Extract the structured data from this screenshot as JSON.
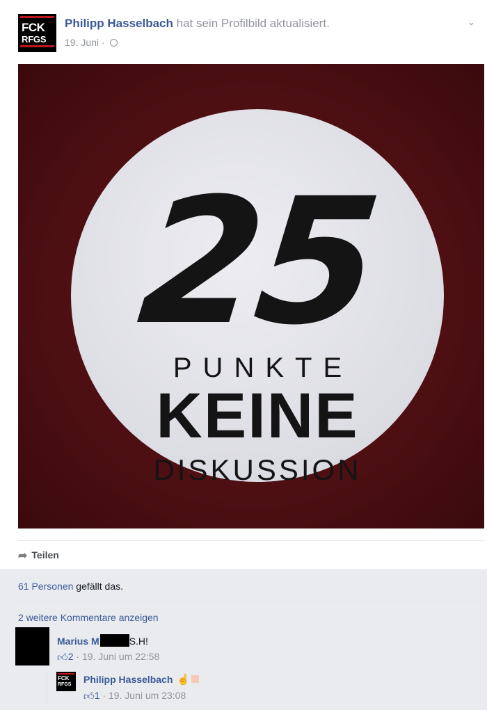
{
  "post": {
    "author": "Philipp Hasselbach",
    "action": "hat sein Profilbild aktualisiert.",
    "date": "19. Juni",
    "separator": "·",
    "avatar": {
      "line1": "FCK",
      "line2": "RFGS"
    },
    "icons": {
      "audience": "globe-icon",
      "options": "chevron-down-icon"
    }
  },
  "image": {
    "number": "25",
    "line1": "PUNKTE",
    "line2": "KEINE",
    "line3": "DISKUSSION",
    "colors": {
      "background": "#4c0f12",
      "circle": "#e3e4e9",
      "text": "#141414"
    }
  },
  "actions": {
    "share_label": "Teilen",
    "share_icon": "share-arrow-icon"
  },
  "likes": {
    "count_link": "61 Personen",
    "suffix": "gefällt das."
  },
  "comments": {
    "more_link": "2 weitere Kommentare anzeigen",
    "items": [
      {
        "name_visible": "Marius M",
        "text": "S.H!",
        "likes": "2",
        "time": "19. Juni um 22:58"
      }
    ],
    "reply": {
      "name": "Philipp Hasselbach",
      "avatar": {
        "line1": "FCK",
        "line2": "RFGS"
      },
      "likes": "1",
      "time": "19. Juni um 23:08"
    }
  },
  "colors": {
    "link": "#3b5998",
    "muted": "#90949c",
    "page_bg": "#e9ebee",
    "card_bg": "#ffffff"
  }
}
